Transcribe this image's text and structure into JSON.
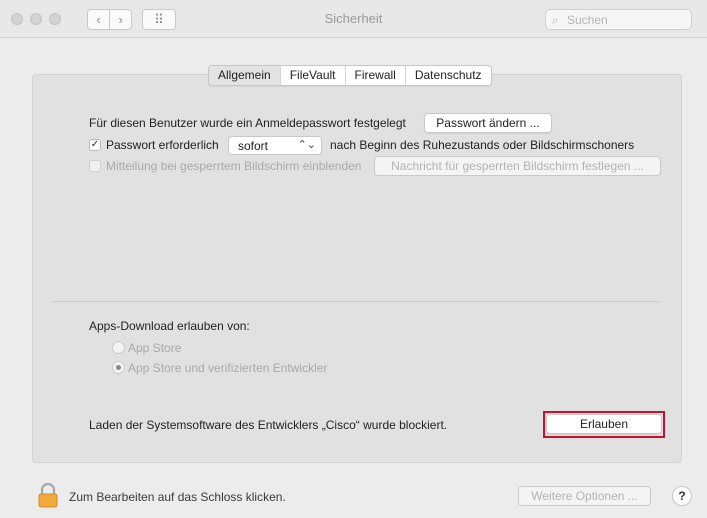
{
  "window": {
    "title": "Sicherheit",
    "search_icon": "⌕",
    "search_placeholder": "Suchen",
    "back_glyph": "‹",
    "forward_glyph": "›",
    "grid_glyph": "⠿"
  },
  "tabs": [
    "Allgemein",
    "FileVault",
    "Firewall",
    "Datenschutz"
  ],
  "general": {
    "password_set_text": "Für diesen Benutzer wurde ein Anmeldepasswort festgelegt",
    "change_password_button": "Passwort ändern ...",
    "require_password_label": "Passwort erforderlich",
    "require_password_checked": true,
    "check_mark": "✓",
    "require_password_select": "sofort",
    "select_arrow": "⌃⌄",
    "after_sleep_text": "nach Beginn des Ruhezustands oder Bildschirmschoners",
    "show_message_label": "Mitteilung bei gesperrtem Bildschirm einblenden",
    "show_message_checked": false,
    "set_message_button": "Nachricht für gesperrten Bildschirm festlegen ...",
    "apps_download_label": "Apps-Download erlauben von:",
    "radio_options": [
      "App Store",
      "App Store und verifizierten Entwickler"
    ],
    "radio_selected_index": 1,
    "blocked_text": "Laden der Systemsoftware des Entwicklers „Cisco“ wurde blockiert.",
    "allow_button": "Erlauben"
  },
  "footer": {
    "lock_text": "Zum Bearbeiten auf das Schloss klicken.",
    "advanced_button": "Weitere Optionen ...",
    "help_label": "?"
  },
  "colors": {
    "highlight": "#c8102e",
    "lock_body": "#f2a93b"
  }
}
